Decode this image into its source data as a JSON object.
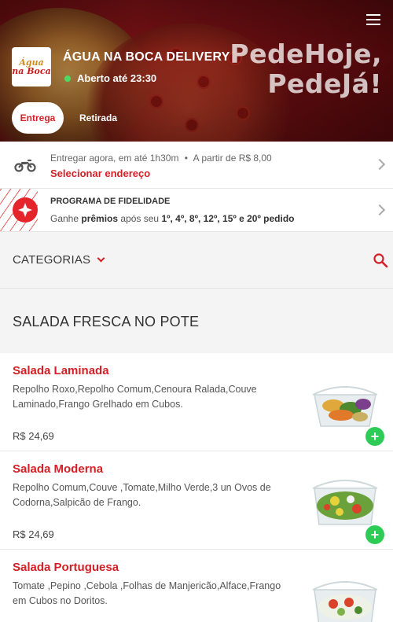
{
  "header": {
    "store_name": "ÁGUA NA BOCA DELIVERY",
    "status": "Aberto até 23:30",
    "slogan_line1": "PedeHoje,",
    "slogan_line2": "PedeJá!",
    "logo_line1": "Água",
    "logo_line2": "na Boca",
    "mode_delivery": "Entrega",
    "mode_pickup": "Retirada",
    "status_color": "#4cd964",
    "brand_color": "#d41f26"
  },
  "delivery": {
    "eta_text": "Entregar agora,",
    "eta_detail": "em até 1h30m",
    "min_price": "A partir de R$ 8,00",
    "select_address": "Selecionar endereço",
    "icon": "motorcycle-icon"
  },
  "loyalty": {
    "title": "PROGRAMA DE FIDELIDADE",
    "text_prefix": "Ganhe",
    "text_bold": "prêmios",
    "text_mid": "após seu",
    "orders": "1º, 4º, 8º, 12º, 15º e 20º pedido",
    "icon": "star-badge-icon"
  },
  "categories": {
    "label": "CATEGORIAS"
  },
  "section": {
    "title": "SALADA FRESCA NO POTE"
  },
  "products": [
    {
      "name": "Salada Laminada",
      "description": "Repolho Roxo,Repolho Comum,Cenoura Ralada,Couve Laminado,Frango Grelhado em Cubos.",
      "price": "R$ 24,69"
    },
    {
      "name": "Salada Moderna",
      "description": "Repolho Comum,Couve ,Tomate,Milho Verde,3 un Ovos de Codorna,Salpicão de Frango.",
      "price": "R$ 24,69"
    },
    {
      "name": "Salada Portuguesa",
      "description": "Tomate ,Pepino ,Cebola ,Folhas de Manjericão,Alface,Frango em Cubos no Doritos.",
      "price": ""
    }
  ],
  "add_label": "+"
}
